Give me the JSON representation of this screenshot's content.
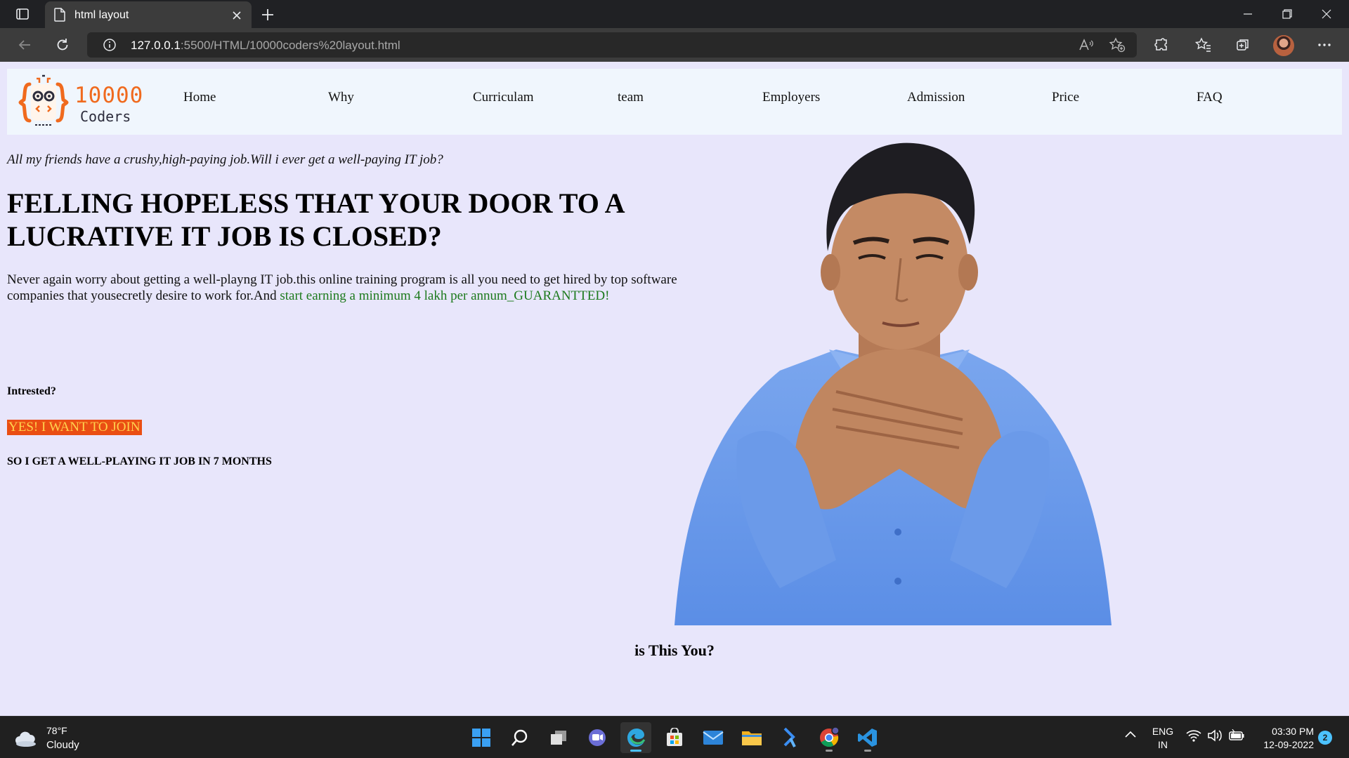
{
  "browser": {
    "tab_title": "html layout",
    "address": {
      "host": "127.0.0.1",
      "path": ":5500/HTML/10000coders%20layout.html"
    }
  },
  "page": {
    "logo": {
      "number": "10000",
      "word": "Coders",
      "brand_color": "#f06a1e"
    },
    "nav": [
      "Home",
      "Why",
      "Curriculam",
      "team",
      "Employers",
      "Admission",
      "Price",
      "FAQ"
    ],
    "intro": "All my friends have a crushy,high-paying job.Will i ever get a well-paying IT job?",
    "headline": "FELLING HOPELESS THAT YOUR DOOR TO A LUCRATIVE IT JOB IS CLOSED?",
    "paragraph": "Never again worry about getting a well-playng IT job.this online training program is all you need to get hired by top software companies that yousecretly desire to work for.And ",
    "paragraph_highlight": "start earning a minimum 4 lakh per annum_GUARANTTED!",
    "interested": "Intrested?",
    "join_button": "YES! I WANT TO JOIN",
    "sub_line": "SO I GET A WELL-PLAYING IT JOB IN 7 MONTHS",
    "question": "is This You?",
    "colors": {
      "background": "#e8e6fb",
      "navbar": "#f0f6fd",
      "highlight": "#1d7a1d",
      "button_bg": "#ea4e13",
      "button_text": "#ffd24d"
    }
  },
  "taskbar": {
    "weather": {
      "temp": "78°F",
      "condition": "Cloudy"
    },
    "apps": [
      "windows-start-icon",
      "search-icon",
      "task-view-icon",
      "teams-chat-icon",
      "edge-icon",
      "store-icon",
      "mail-icon",
      "file-explorer-icon",
      "power-automate-icon",
      "chrome-icon",
      "vscode-icon"
    ],
    "lang": {
      "line1": "ENG",
      "line2": "IN"
    },
    "clock": {
      "time": "03:30 PM",
      "date": "12-09-2022"
    },
    "notification_count": "2"
  }
}
